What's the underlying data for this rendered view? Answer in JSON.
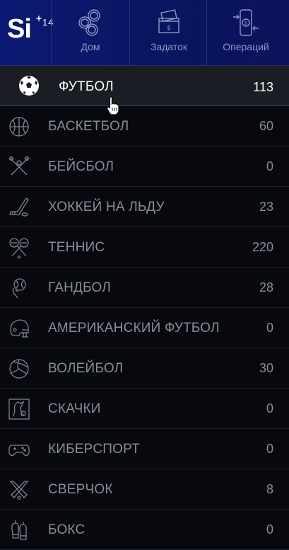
{
  "brand": {
    "logo_text": "Si",
    "logo_superscript": "14"
  },
  "nav": [
    {
      "label": "Дом",
      "icon": "coins-icon"
    },
    {
      "label": "Задаток",
      "icon": "deposit-icon"
    },
    {
      "label": "Операций",
      "icon": "phone-transfer-icon"
    }
  ],
  "sports": [
    {
      "label": "ФУТБОЛ",
      "count": "113",
      "icon": "soccer-ball-icon",
      "active": true
    },
    {
      "label": "БАСКЕТБОЛ",
      "count": "60",
      "icon": "basketball-icon"
    },
    {
      "label": "БЕЙСБОЛ",
      "count": "0",
      "icon": "baseball-bats-icon"
    },
    {
      "label": "ХОККЕЙ НА ЛЬДУ",
      "count": "23",
      "icon": "hockey-stick-icon"
    },
    {
      "label": "ТЕННИС",
      "count": "220",
      "icon": "tennis-rackets-icon"
    },
    {
      "label": "ГАНДБОЛ",
      "count": "28",
      "icon": "handball-icon"
    },
    {
      "label": "АМЕРИКАНСКИЙ ФУТБОЛ",
      "count": "0",
      "icon": "football-helmet-icon"
    },
    {
      "label": "ВОЛЕЙБОЛ",
      "count": "30",
      "icon": "volleyball-icon"
    },
    {
      "label": "СКАЧКИ",
      "count": "0",
      "icon": "horse-racing-icon"
    },
    {
      "label": "КИБЕРСПОРТ",
      "count": "0",
      "icon": "gamepad-icon"
    },
    {
      "label": "СВЕРЧОК",
      "count": "8",
      "icon": "cricket-bats-icon"
    },
    {
      "label": "БОКС",
      "count": "0",
      "icon": "boxing-gloves-icon"
    }
  ],
  "colors": {
    "header_bg": "#0c1a74",
    "list_bg": "#08090f",
    "active_row_bg": "#1b1d25",
    "text_muted": "#888d98",
    "text_active": "#ffffff"
  }
}
